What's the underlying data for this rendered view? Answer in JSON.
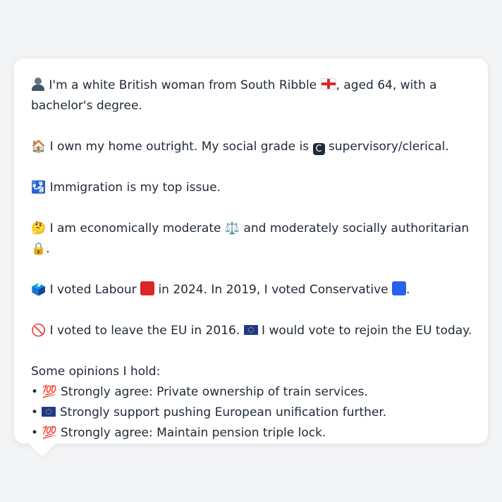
{
  "lines": {
    "l1a": "I'm a white British woman from South Ribble",
    "l1b": ", aged 64, with a",
    "l1c": "bachelor's degree.",
    "l2a": "I own my home outright. My social grade is",
    "l2b": "supervisory/clerical.",
    "l3": "Immigration is my top issue.",
    "l4a": "I am economically moderate",
    "l4b": "and moderately socially authoritarian",
    "l4c": ".",
    "l5a": "I voted Labour",
    "l5b": "in 2024. In 2019, I voted Conservative",
    "l5c": ".",
    "l6a": "I voted to leave the EU in 2016.",
    "l6b": "I would vote to rejoin the EU today.",
    "opinions_heading": "Some opinions I hold:",
    "opinions": [
      "Strongly agree: Private ownership of train services.",
      "Strongly support pushing European unification further.",
      "Strongly agree: Maintain pension triple lock."
    ]
  },
  "glyphs": {
    "house": "🏠",
    "grade": "C",
    "immigration": "🛂",
    "thinking": "🤔",
    "scales": "⚖️",
    "lock": "🔒",
    "ballot": "🗳️",
    "no": "🚫",
    "hundred": "💯",
    "bullet": "•"
  },
  "colors": {
    "labour": "#dc2626",
    "conservative": "#2563eb",
    "text": "#1f2937",
    "background": "#f3f4f6"
  }
}
